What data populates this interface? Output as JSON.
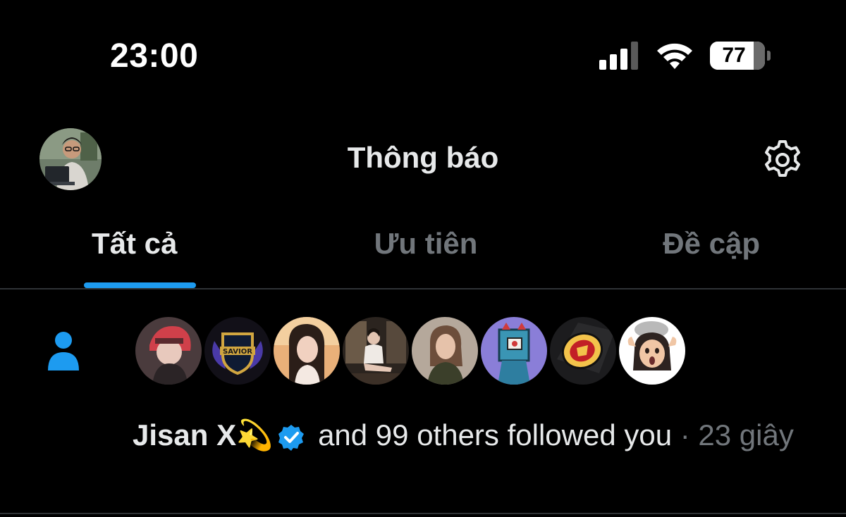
{
  "status_bar": {
    "time": "23:00",
    "battery_percent": "77",
    "battery_level": 0.77,
    "signal_icon": "cellular-signal-icon",
    "wifi_icon": "wifi-icon"
  },
  "header": {
    "title": "Thông báo",
    "avatar_icon": "profile-avatar",
    "settings_icon": "gear-icon"
  },
  "tabs": [
    {
      "label": "Tất cả",
      "active": true
    },
    {
      "label": "Ưu tiên",
      "active": false
    },
    {
      "label": "Đề cập",
      "active": false
    }
  ],
  "notification": {
    "type_icon": "person-icon",
    "avatars": [
      "avatar-anime-boy",
      "avatar-savior-logo",
      "avatar-girl-sunset",
      "avatar-girl-sitting",
      "avatar-woman-portrait",
      "avatar-robot-nft",
      "avatar-manchester-united",
      "avatar-memoji"
    ],
    "name": "Jisan X",
    "emoji": "💫",
    "verified_icon": "verified-badge-icon",
    "message": "and 99 others followed you",
    "separator": "·",
    "time_ago": "23 giây"
  },
  "colors": {
    "background": "#000000",
    "text": "#e7e9ea",
    "muted": "#71767b",
    "accent": "#1d9bf0",
    "divider": "#2f3336"
  }
}
